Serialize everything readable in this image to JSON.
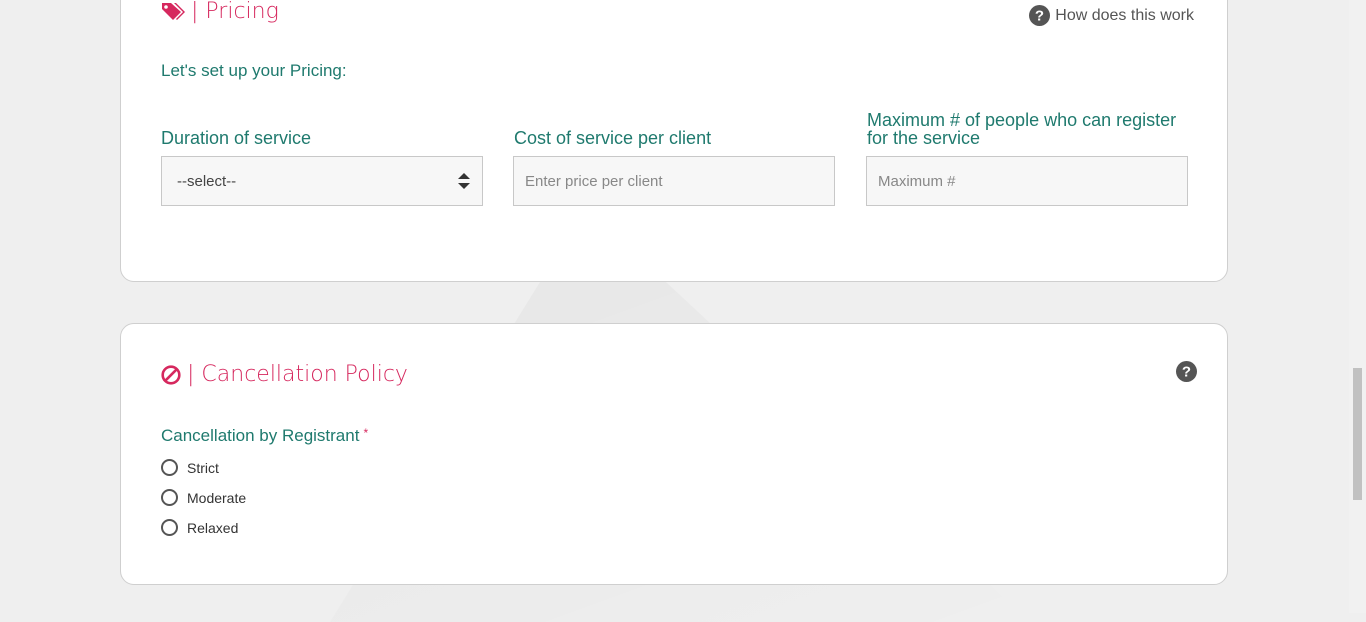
{
  "pricing": {
    "title": "| Pricing",
    "help_link": "How does this work",
    "intro": "Let's set up your Pricing:",
    "duration_label": "Duration of service",
    "duration_value": "--select--",
    "cost_label": "Cost of service per client",
    "cost_placeholder": "Enter price per client",
    "max_label": "Maximum # of people who can register for the service",
    "max_placeholder": "Maximum #"
  },
  "cancellation": {
    "title": "| Cancellation Policy",
    "label": "Cancellation by Registrant",
    "required_mark": "*",
    "options": [
      "Strict",
      "Moderate",
      "Relaxed"
    ]
  },
  "icons": {
    "pricing": "tags-icon",
    "cancel": "ban-icon",
    "help": "question-circle-icon"
  },
  "colors": {
    "accent": "#d6285e",
    "label": "#1f7a6e"
  }
}
